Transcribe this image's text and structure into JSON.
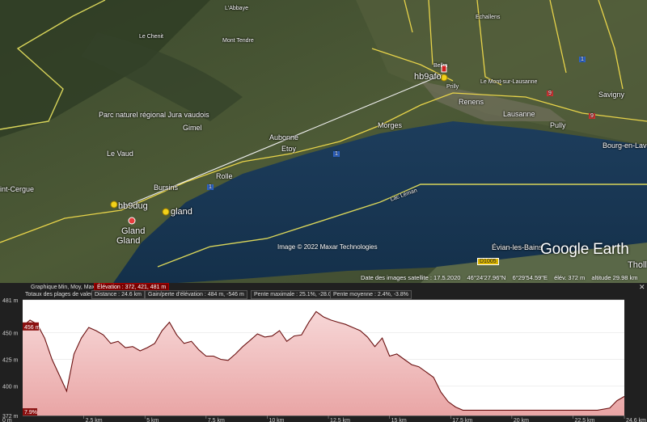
{
  "map": {
    "places": {
      "labbaye": "L'Abbaye",
      "le_chenit": "Le Chenit",
      "mont_tendre": "Mont Tendre",
      "echallens": "Echallens",
      "parc": "Parc naturel régional Jura vaudois",
      "gimel": "Gimel",
      "aubonne": "Aubonne",
      "le_vaud": "Le Vaud",
      "etoy": "Etoy",
      "morges": "Morges",
      "bursins": "Bursins",
      "rolle": "Rolle",
      "renens": "Renens",
      "lausanne": "Lausanne",
      "le_mont": "Le Mont-sur-Lausanne",
      "savigny": "Savigny",
      "pully": "Pully",
      "bourg": "Bourg-en-Lava",
      "cergue": "int-Cergue",
      "gland": "Gland",
      "gland2": "Gland",
      "lac": "Lac Léman",
      "evian": "Évian-les-Bains",
      "thollon": "Thollo",
      "bellm": "Bellm",
      "prilly": "Prilly"
    },
    "placemarks": {
      "hb9dug": "hb9dug",
      "gland": "gland",
      "hb9afo": "hb9afo"
    },
    "road_badges": [
      "9",
      "9",
      "1",
      "1",
      "1"
    ],
    "road_label": "D1005",
    "copyright": "Image © 2022 Maxar Technologies",
    "logo": "Google Earth",
    "status": {
      "date": "Date des images satellite : 17.5.2020",
      "lat": "46°24'27.96\"N",
      "lon": "6°29'54.59\"E",
      "elev": "élév.  372 m",
      "alt": "altitude  29.98 km"
    }
  },
  "profile": {
    "tabs": {
      "graph": "Graphique :",
      "min": "Min, Moy, Max",
      "elev": "Élévation : 372, 421, 481 m"
    },
    "totals_label": "Totaux des plages de valeurs :",
    "distance": "Distance : 24.6 km",
    "gain": "Gain/perte d'élévation : 484 m, -546 m",
    "max_slope": "Pente maximale : 25.1%, -28.0%",
    "avg_slope": "Pente moyenne : 2.4%, -3.8%",
    "close": "✕",
    "y_ticks": [
      "481 m",
      "450 m",
      "425 m",
      "400 m",
      "372 m"
    ],
    "marker_top": "456 m",
    "marker_bottom": "7.9%",
    "origin": "0 m",
    "x_ticks": [
      "2.5 km",
      "5 km",
      "7.5 km",
      "10 km",
      "12.5 km",
      "15 km",
      "17.5 km",
      "20 km",
      "22.5 km",
      "24.6 km"
    ]
  },
  "chart_data": {
    "type": "area",
    "title": "",
    "xlabel": "",
    "ylabel": "",
    "xlim": [
      0,
      24.6
    ],
    "ylim": [
      372,
      481
    ],
    "x": [
      0,
      0.3,
      0.6,
      0.9,
      1.2,
      1.5,
      1.8,
      2.1,
      2.4,
      2.7,
      3.0,
      3.3,
      3.6,
      3.9,
      4.2,
      4.5,
      4.8,
      5.1,
      5.4,
      5.7,
      6.0,
      6.3,
      6.6,
      6.9,
      7.2,
      7.5,
      7.8,
      8.1,
      8.4,
      8.7,
      9.0,
      9.3,
      9.6,
      9.9,
      10.2,
      10.5,
      10.8,
      11.1,
      11.4,
      11.7,
      12.0,
      12.3,
      12.6,
      12.9,
      13.2,
      13.5,
      13.8,
      14.1,
      14.4,
      14.7,
      15.0,
      15.3,
      15.6,
      15.9,
      16.2,
      16.5,
      16.8,
      17.1,
      17.4,
      17.7,
      18.0,
      18.5,
      19.0,
      19.5,
      20.0,
      20.5,
      21.0,
      21.5,
      22.0,
      22.5,
      23.0,
      23.5,
      24.0,
      24.3,
      24.6
    ],
    "y": [
      456,
      462,
      458,
      445,
      425,
      410,
      395,
      430,
      445,
      455,
      452,
      448,
      440,
      442,
      436,
      437,
      433,
      436,
      440,
      452,
      460,
      448,
      440,
      442,
      434,
      428,
      428,
      425,
      424,
      430,
      437,
      443,
      449,
      446,
      447,
      452,
      442,
      447,
      448,
      460,
      470,
      465,
      462,
      460,
      458,
      455,
      452,
      446,
      437,
      445,
      428,
      430,
      425,
      420,
      418,
      413,
      408,
      394,
      385,
      380,
      377,
      377,
      377,
      377,
      377,
      377,
      377,
      377,
      377,
      377,
      377,
      377,
      379,
      386,
      390
    ]
  }
}
